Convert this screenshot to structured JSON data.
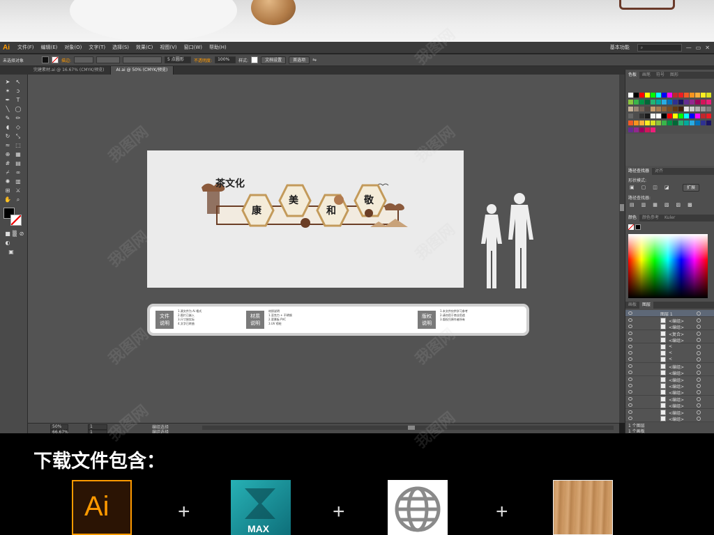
{
  "menubar": {
    "logo": "Ai",
    "items": [
      "文件(F)",
      "编辑(E)",
      "对象(O)",
      "文字(T)",
      "选择(S)",
      "效果(C)",
      "视图(V)",
      "窗口(W)",
      "帮助(H)"
    ],
    "workspace": "基本功能",
    "search_placeholder": ""
  },
  "control_bar": {
    "selection": "未选择对象",
    "stroke_label": "描边:",
    "pts_value": "5 点圆形",
    "opacity_label": "不透明度:",
    "opacity_value": "100%",
    "style_label": "样式:",
    "doc_setup": "文档设置",
    "preferences": "首选项"
  },
  "tabs": [
    {
      "label": "完建素材.ai @ 16.67% (CMYK/预览)",
      "active": false
    },
    {
      "label": "AI.ai @ 50% (CMYK/预览)",
      "active": true
    }
  ],
  "status": {
    "zoom1": "50%",
    "zoom2": "66.67%",
    "page1": "1",
    "page2": "1",
    "mode1": "编组选择",
    "mode2": "编组选择"
  },
  "panels": {
    "swatch_tabs": [
      "色板",
      "画笔",
      "符号",
      "图形"
    ],
    "pathfinder_tabs": [
      "路径查找器",
      "对齐"
    ],
    "shape_modes": "形状模式:",
    "expand": "扩展",
    "pathfinder_label": "路径查找器:",
    "color_tabs": [
      "颜色",
      "颜色参考",
      "Kuler"
    ],
    "layer_tabs": [
      "画板",
      "图层"
    ],
    "layer_top": "图层 1",
    "layer_rows": [
      "<编组>",
      "<编组>",
      "<复合>",
      "<编组>",
      "<",
      "<",
      "<",
      "<编组>",
      "<编组>",
      "<编组>",
      "<编组>",
      "<编组>",
      "<编组>",
      "<编组>",
      "<编组>",
      "<编组>"
    ],
    "layer_footer1": "1 个图层",
    "layer_footer2": "1 个画板"
  },
  "artwork": {
    "title": "茶文化",
    "chars": [
      "康",
      "美",
      "和",
      "敬"
    ]
  },
  "info_panel": {
    "sections": [
      {
        "title": "文件\n说明",
        "text": "1.源文件为 Ai 格式\n2.图片已嵌入\n3.尺寸按实际\n4.文字已转曲"
      },
      {
        "title": "材质\n说明",
        "text": "材质说明\n1.亚克力 + 不锈钢\n2.背景板 PVC\n3.UV 喷绘"
      },
      {
        "title": "版权\n说明",
        "text": "1.本文件仅供学习参考\n2.请勿用于商业用途\n3.版权归原作者所有"
      }
    ]
  },
  "bottom": {
    "title": "下载文件包含：",
    "items": [
      {
        "icon": "ai-icon",
        "label": "Ai"
      },
      {
        "icon": "max-icon",
        "label": "MAX"
      },
      {
        "icon": "globe-icon",
        "label": ""
      },
      {
        "icon": "wood-texture-icon",
        "label": ""
      }
    ],
    "plus": "+"
  },
  "watermark": "我图网",
  "colors": {
    "ai_orange": "#ff9a00",
    "max_teal": "#1fa3a8",
    "wood": "#c8955f"
  }
}
